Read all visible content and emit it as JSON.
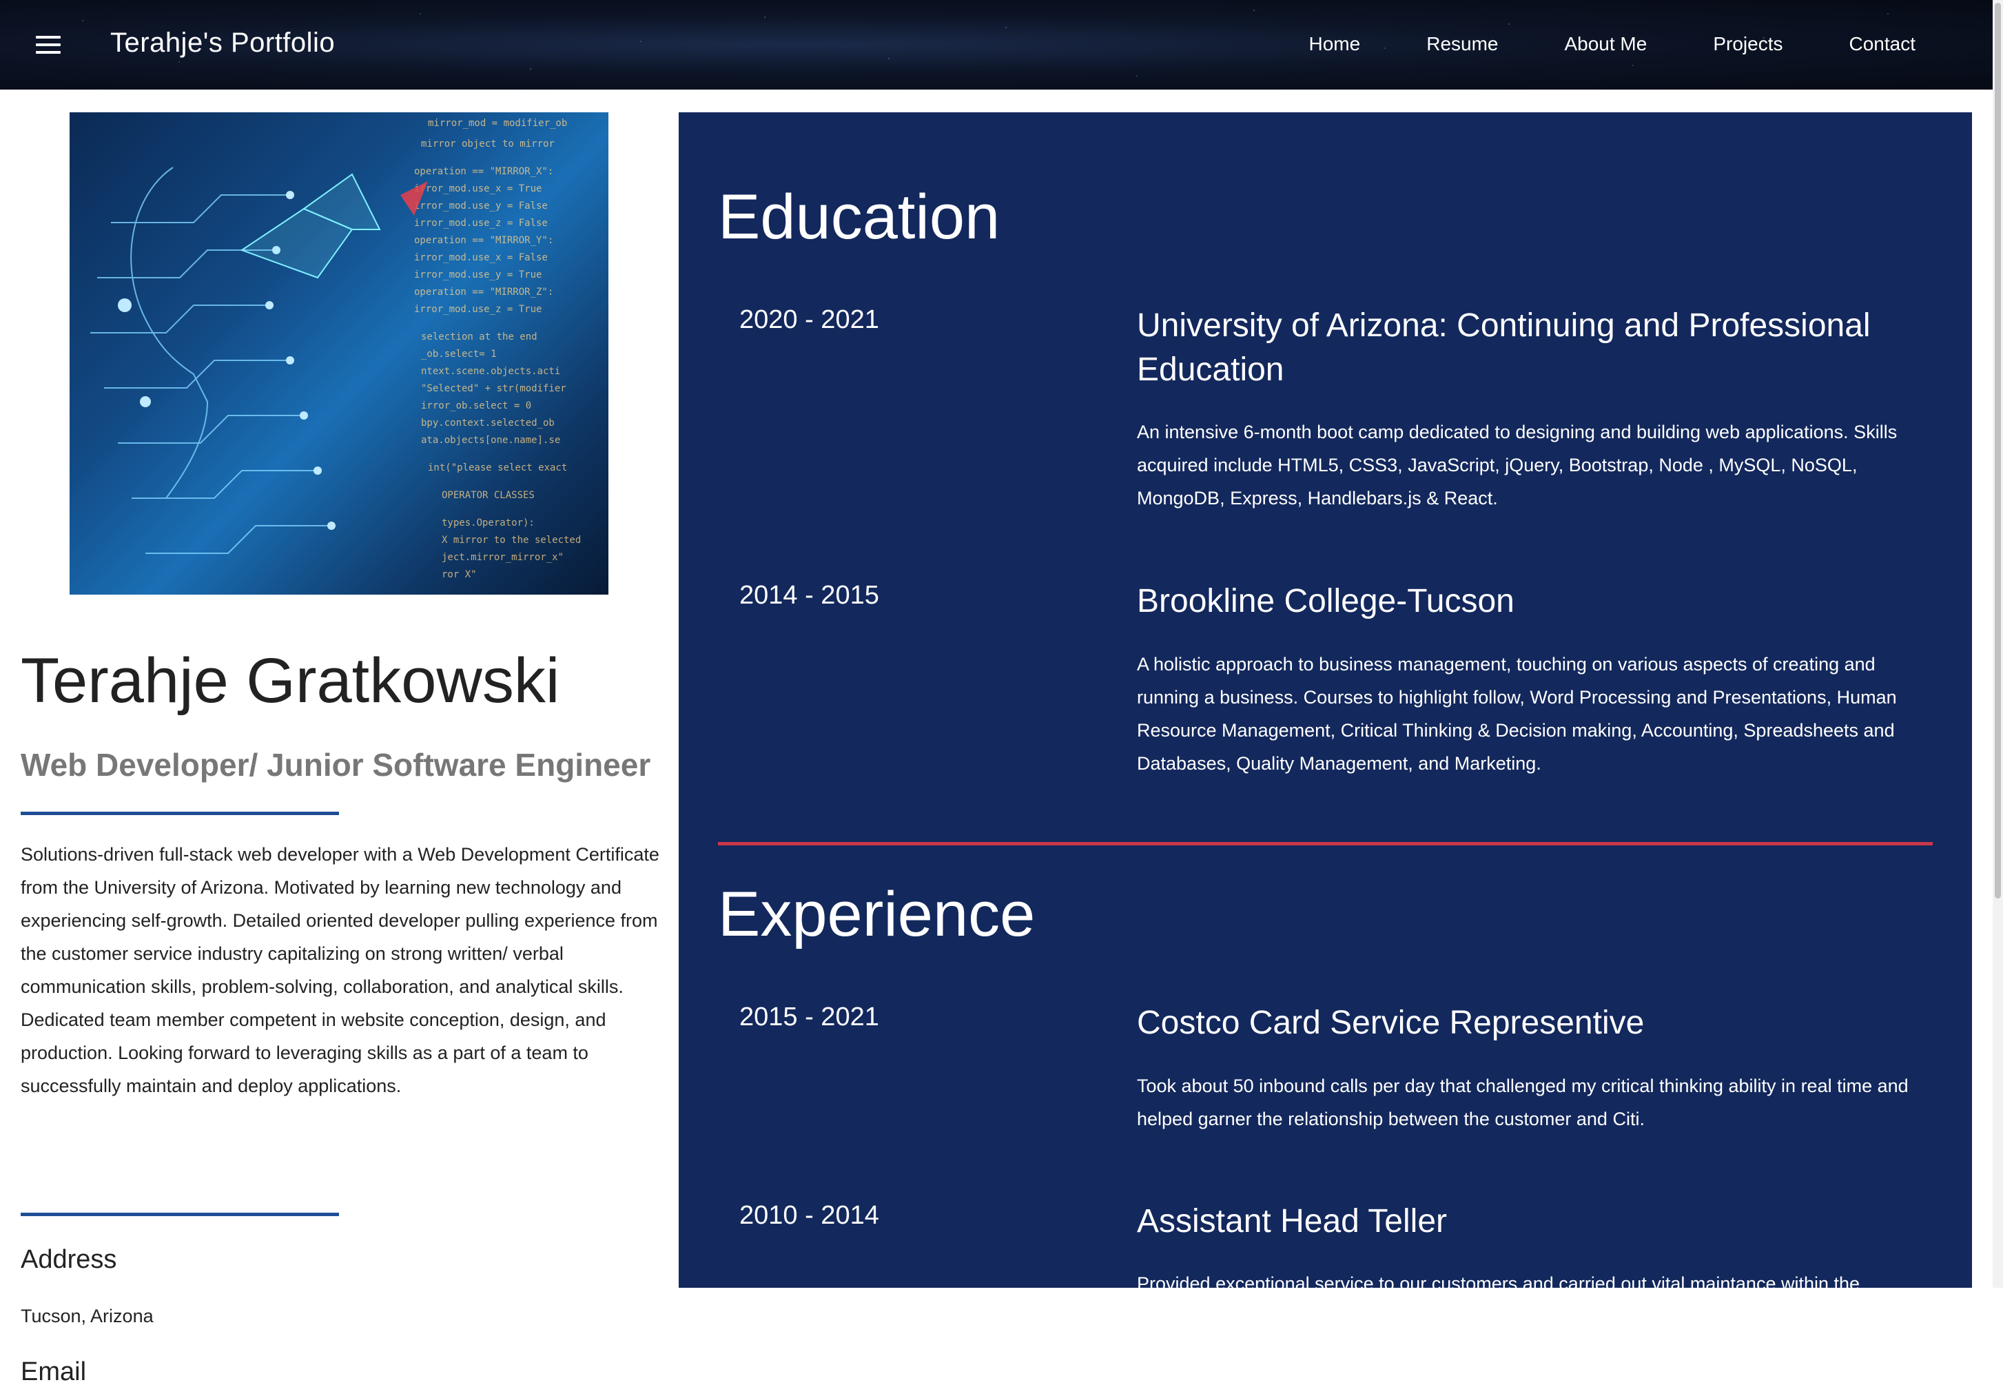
{
  "navbar": {
    "brand": "Terahje's Portfolio",
    "menu_icon": "hamburger-menu-icon",
    "links": [
      "Home",
      "Resume",
      "About Me",
      "Projects",
      "Contact"
    ]
  },
  "profile": {
    "image_icon": "ai-circuit-face-image",
    "name": "Terahje Gratkowski",
    "subtitle": "Web Developer/ Junior Software Engineer",
    "bio": "Solutions-driven full-stack web developer with a Web Development Certificate from the University of Arizona. Motivated by learning new technology and experiencing self-growth. Detailed oriented developer pulling experience from the customer service industry capitalizing on strong written/ verbal communication skills, problem-solving, collaboration, and analytical skills. Dedicated team member competent in website conception, design, and production. Looking forward to leveraging skills as a part of a team to successfully maintain and deploy applications.",
    "address_label": "Address",
    "address_value": "Tucson, Arizona",
    "email_label": "Email"
  },
  "education": {
    "title": "Education",
    "entries": [
      {
        "years": "2020 - 2021",
        "title": "University of Arizona: Continuing and Professional Education",
        "description": "An intensive 6-month boot camp dedicated to designing and building web applications. Skills acquired include HTML5, CSS3, JavaScript, jQuery, Bootstrap, Node , MySQL, NoSQL, MongoDB, Express, Handlebars.js & React."
      },
      {
        "years": "2014 - 2015",
        "title": "Brookline College-Tucson",
        "description": "A holistic approach to business management, touching on various aspects of creating and running a business. Courses to highlight follow, Word Processing and Presentations, Human Resource Management, Critical Thinking & Decision making, Accounting, Spreadsheets and Databases, Quality Management, and Marketing."
      }
    ]
  },
  "experience": {
    "title": "Experience",
    "entries": [
      {
        "years": "2015 - 2021",
        "title": "Costco Card Service Representive",
        "description": "Took about 50 inbound calls per day that challenged my critical thinking ability in real time and helped garner the relationship between the customer and Citi."
      },
      {
        "years": "2010 - 2014",
        "title": "Assistant Head Teller",
        "description": "Provided exceptional service to our customers and carried out vital maintance within the"
      }
    ]
  },
  "colors": {
    "panel": "#13285c",
    "accent_blue": "#1f4e96",
    "accent_red": "#c8374a"
  }
}
